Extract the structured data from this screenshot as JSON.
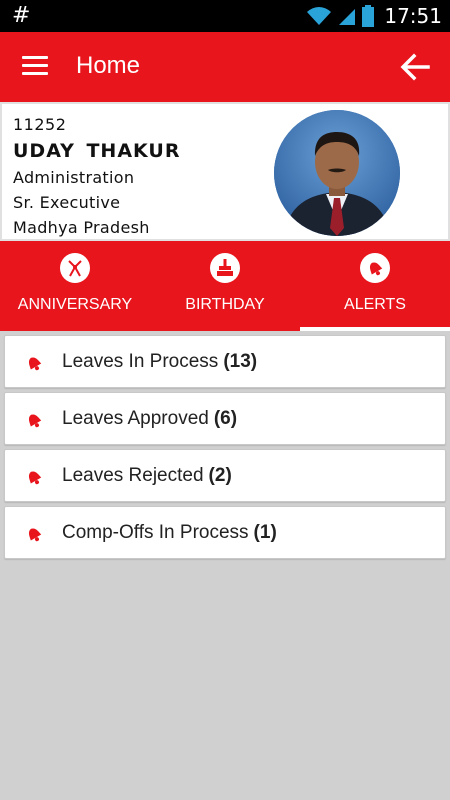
{
  "status_bar": {
    "left_glyph": "#",
    "time": "17:51"
  },
  "toolbar": {
    "title": "Home",
    "menu_icon": "hamburger-menu-icon",
    "back_icon": "arrow-left-icon"
  },
  "profile": {
    "employee_id": "11252",
    "name": "UDAY  THAKUR",
    "department": "Administration",
    "designation": "Sr. Executive",
    "location": "Madhya Pradesh"
  },
  "tabs": [
    {
      "label": "ANNIVERSARY",
      "icon": "anniversary-icon",
      "selected": false
    },
    {
      "label": "BIRTHDAY",
      "icon": "birthday-cake-icon",
      "selected": false
    },
    {
      "label": "ALERTS",
      "icon": "bell-icon",
      "selected": true
    }
  ],
  "alerts": [
    {
      "label": "Leaves In Process",
      "count": "(13)"
    },
    {
      "label": "Leaves Approved",
      "count": "(6)"
    },
    {
      "label": "Leaves Rejected",
      "count": "(2)"
    },
    {
      "label": "Comp-Offs In Process",
      "count": "(1)"
    }
  ],
  "colors": {
    "primary": "#e8151d",
    "background": "#d0d0d0",
    "card": "#ffffff"
  }
}
